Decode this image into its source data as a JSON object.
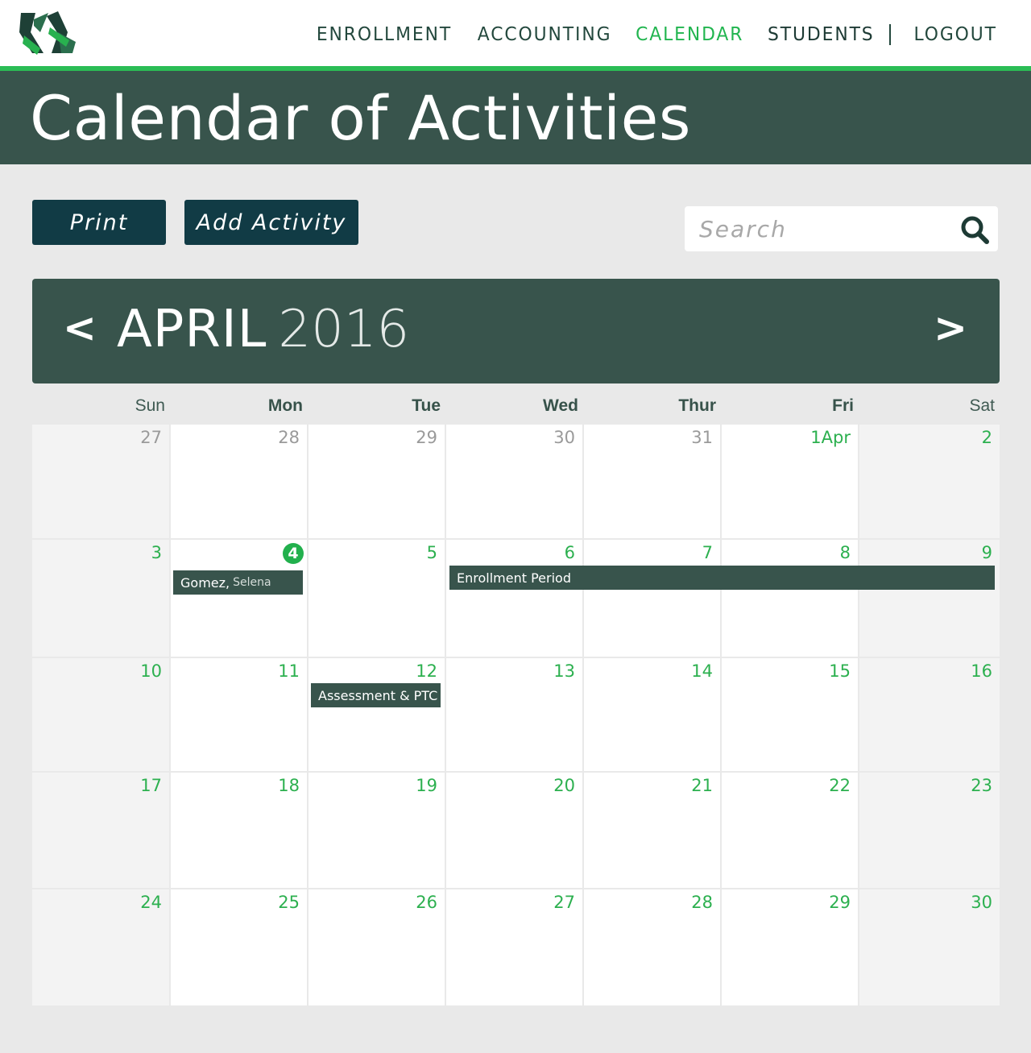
{
  "nav": {
    "items": [
      {
        "label": "ENROLLMENT",
        "active": false
      },
      {
        "label": "ACCOUNTING",
        "active": false
      },
      {
        "label": "CALENDAR",
        "active": true
      },
      {
        "label": "STUDENTS",
        "active": false
      },
      {
        "label": "LOGOUT",
        "active": false
      }
    ]
  },
  "page": {
    "title": "Calendar of Activities"
  },
  "toolbar": {
    "print_label": "Print",
    "add_label": "Add Activity",
    "search_placeholder": "Search"
  },
  "calendar": {
    "month": "APRIL",
    "year": "2016",
    "prev": "<",
    "next": ">",
    "weekdays": [
      "Sun",
      "Mon",
      "Tue",
      "Wed",
      "Thur",
      "Fri",
      "Sat"
    ],
    "weeks": [
      [
        "27",
        "28",
        "29",
        "30",
        "31",
        "1Apr",
        "2"
      ],
      [
        "3",
        "4",
        "5",
        "6",
        "7",
        "8",
        "9"
      ],
      [
        "10",
        "11",
        "12",
        "13",
        "14",
        "15",
        "16"
      ],
      [
        "17",
        "18",
        "19",
        "20",
        "21",
        "22",
        "23"
      ],
      [
        "24",
        "25",
        "26",
        "27",
        "28",
        "29",
        "30"
      ]
    ],
    "today": "4",
    "events": {
      "student_last": "Gomez,",
      "student_first": "Selena",
      "enrollment": "Enrollment Period",
      "assessment": "Assessment & PTC"
    }
  },
  "colors": {
    "accent": "#21b54f",
    "dark_green": "#38544c",
    "button": "#113b45",
    "background": "#e9e9e9"
  }
}
